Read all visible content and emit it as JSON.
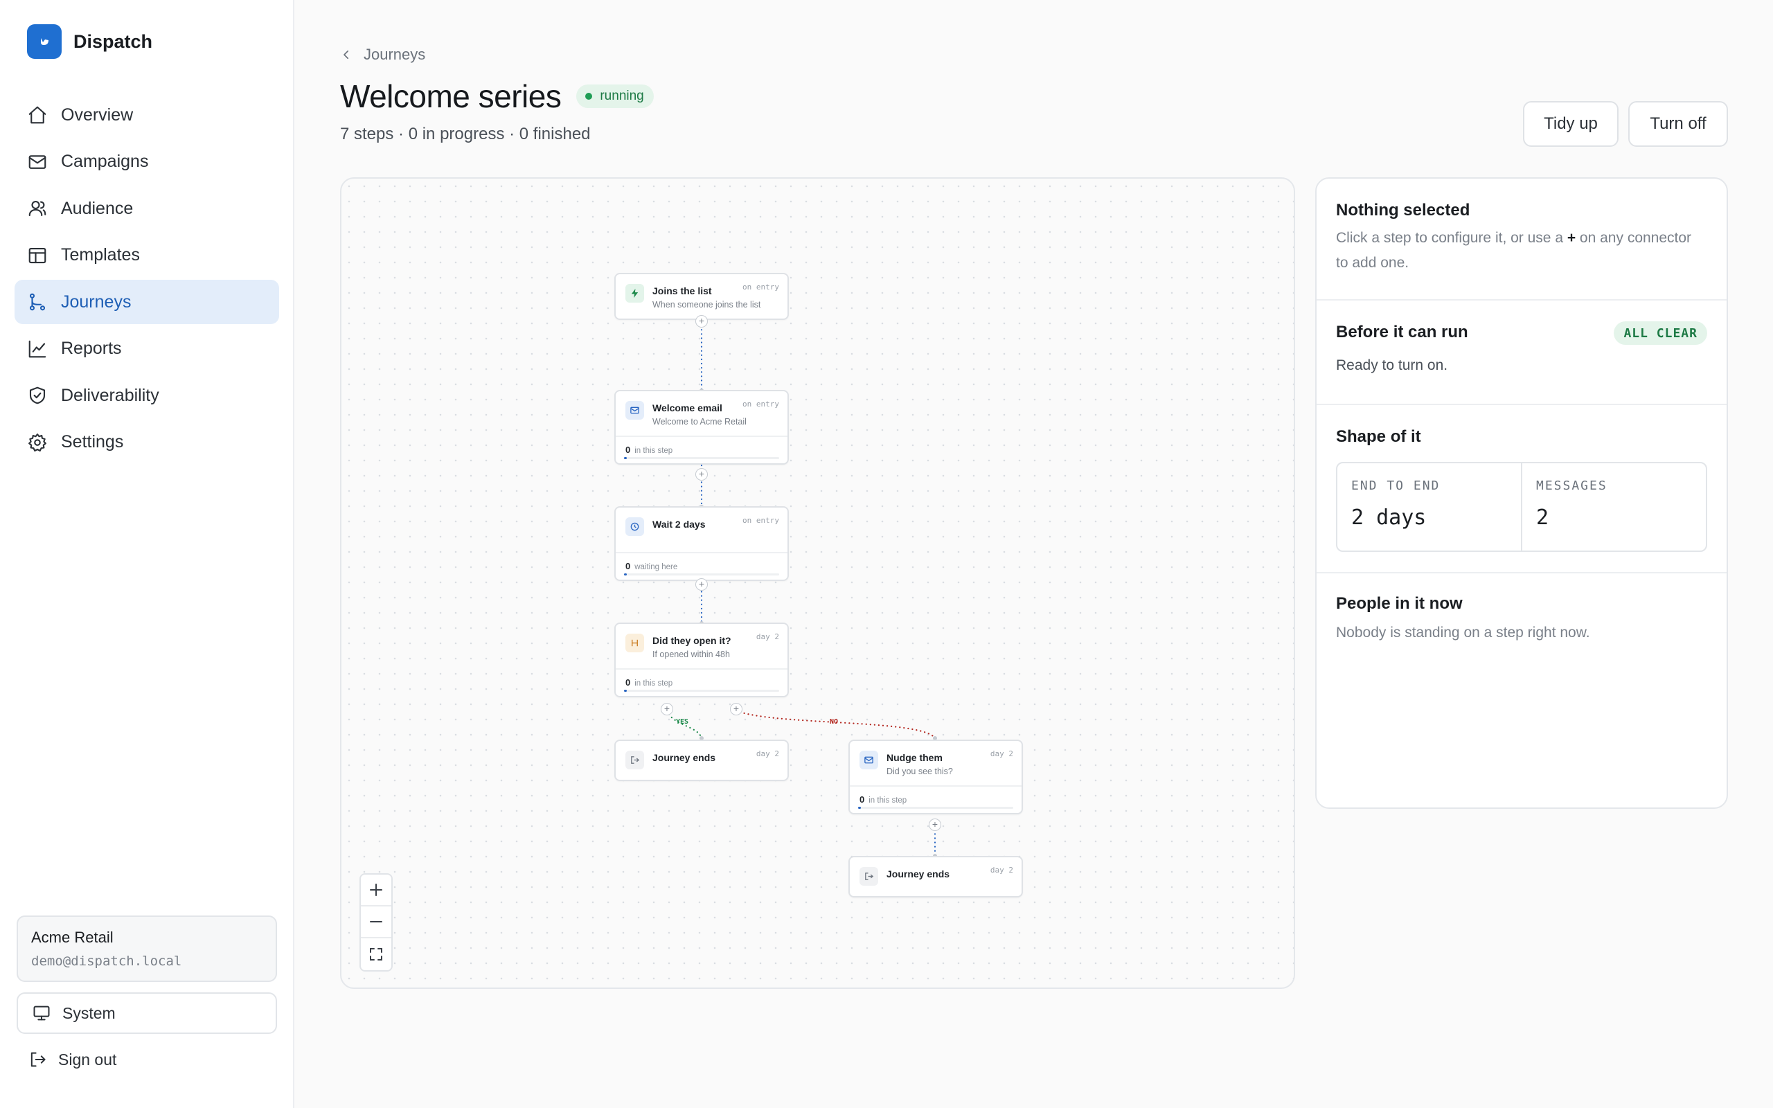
{
  "brand": {
    "name": "Dispatch"
  },
  "nav": [
    {
      "label": "Overview",
      "icon": "home-icon"
    },
    {
      "label": "Campaigns",
      "icon": "mail-icon"
    },
    {
      "label": "Audience",
      "icon": "users-icon"
    },
    {
      "label": "Templates",
      "icon": "layout-icon"
    },
    {
      "label": "Journeys",
      "icon": "route-icon",
      "active": true
    },
    {
      "label": "Reports",
      "icon": "chart-line-icon"
    },
    {
      "label": "Deliverability",
      "icon": "shield-check-icon"
    },
    {
      "label": "Settings",
      "icon": "gear-icon"
    }
  ],
  "account": {
    "name": "Acme Retail",
    "email": "demo@dispatch.local"
  },
  "theme": {
    "label": "System"
  },
  "signout": {
    "label": "Sign out"
  },
  "header": {
    "breadcrumb": "Journeys",
    "title": "Welcome series",
    "status": "running",
    "subtitle": "7 steps · 0 in progress · 0 finished",
    "tidy_label": "Tidy up",
    "off_label": "Turn off"
  },
  "colors": {
    "accent": "#1f6fd1",
    "running": "#1f9d55",
    "yes_branch": "#1d8a4b",
    "no_branch": "#b3261e"
  },
  "flow": {
    "nodes": [
      {
        "title": "Joins the list",
        "sub": "When someone joins the list",
        "tag": "on entry",
        "icon": "bolt-icon"
      },
      {
        "title": "Welcome email",
        "sub": "Welcome to Acme Retail",
        "tag": "on entry",
        "icon": "mail-icon",
        "count": "0",
        "count_label": "in this step"
      },
      {
        "title": "Wait 2 days",
        "tag": "on entry",
        "icon": "clock-icon",
        "count": "0",
        "count_label": "waiting here"
      },
      {
        "title": "Did they open it?",
        "sub": "If opened within 48h",
        "tag": "day 2",
        "icon": "split-icon",
        "count": "0",
        "count_label": "in this step"
      },
      {
        "title": "Journey ends",
        "tag": "day 2",
        "icon": "exit-icon"
      },
      {
        "title": "Nudge them",
        "sub": "Did you see this?",
        "tag": "day 2",
        "icon": "mail-icon",
        "count": "0",
        "count_label": "in this step"
      },
      {
        "title": "Journey ends",
        "tag": "day 2",
        "icon": "exit-icon"
      }
    ],
    "yes_label": "YES",
    "no_label": "NO",
    "plus": "+"
  },
  "panel": {
    "selection_title": "Nothing selected",
    "selection_text_before": "Click a step to configure it, or use a ",
    "selection_plus": "+",
    "selection_text_after": " on any connector to add one.",
    "run_title": "Before it can run",
    "run_badge": "ALL CLEAR",
    "run_text": "Ready to turn on.",
    "shape_title": "Shape of it",
    "stats": [
      {
        "label": "END TO END",
        "value": "2 days"
      },
      {
        "label": "MESSAGES",
        "value": "2"
      }
    ],
    "people_title": "People in it now",
    "people_text": "Nobody is standing on a step right now."
  }
}
